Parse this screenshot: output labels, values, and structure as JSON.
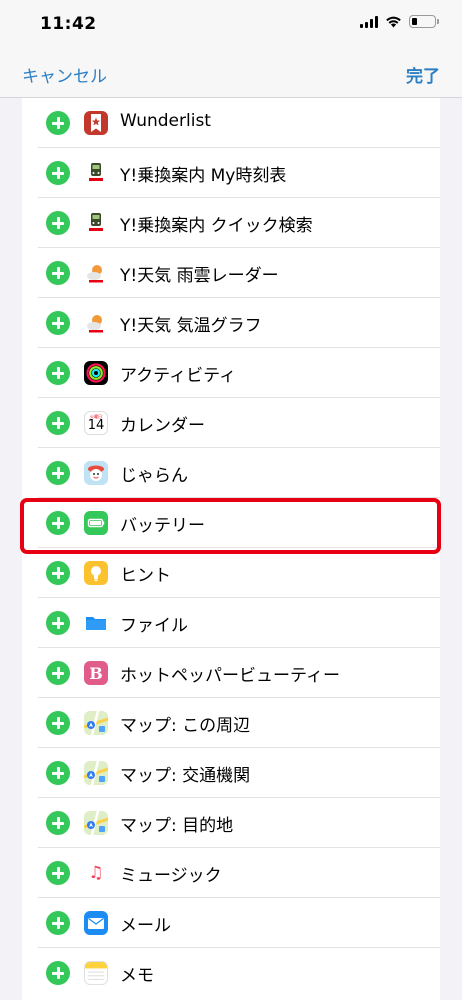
{
  "status": {
    "time": "11:42"
  },
  "nav": {
    "cancel_label": "キャンセル",
    "done_label": "完了"
  },
  "colors": {
    "accent": "#2d7fc4",
    "add": "#34c759",
    "highlight": "#e60012"
  },
  "items": [
    {
      "label": "Wunderlist",
      "icon": "wunderlist-icon"
    },
    {
      "label": "Y!乗換案内 My時刻表",
      "icon": "yahoo-transit-icon"
    },
    {
      "label": "Y!乗換案内 クイック検索",
      "icon": "yahoo-transit-icon"
    },
    {
      "label": "Y!天気 雨雲レーダー",
      "icon": "yahoo-weather-icon"
    },
    {
      "label": "Y!天気 気温グラフ",
      "icon": "yahoo-weather-icon"
    },
    {
      "label": "アクティビティ",
      "icon": "activity-icon"
    },
    {
      "label": "カレンダー",
      "icon": "calendar-icon",
      "icon_day": "火曜日",
      "icon_date": "14"
    },
    {
      "label": "じゃらん",
      "icon": "jalan-icon"
    },
    {
      "label": "バッテリー",
      "icon": "battery-icon"
    },
    {
      "label": "ヒント",
      "icon": "tips-icon"
    },
    {
      "label": "ファイル",
      "icon": "files-icon"
    },
    {
      "label": "ホットペッパービューティー",
      "icon": "hotpepper-beauty-icon",
      "icon_glyph": "B"
    },
    {
      "label": "マップ: この周辺",
      "icon": "maps-icon"
    },
    {
      "label": "マップ: 交通機関",
      "icon": "maps-icon"
    },
    {
      "label": "マップ: 目的地",
      "icon": "maps-icon"
    },
    {
      "label": "ミュージック",
      "icon": "music-icon",
      "icon_glyph": "♫"
    },
    {
      "label": "メール",
      "icon": "mail-icon"
    },
    {
      "label": "メモ",
      "icon": "notes-icon"
    }
  ]
}
